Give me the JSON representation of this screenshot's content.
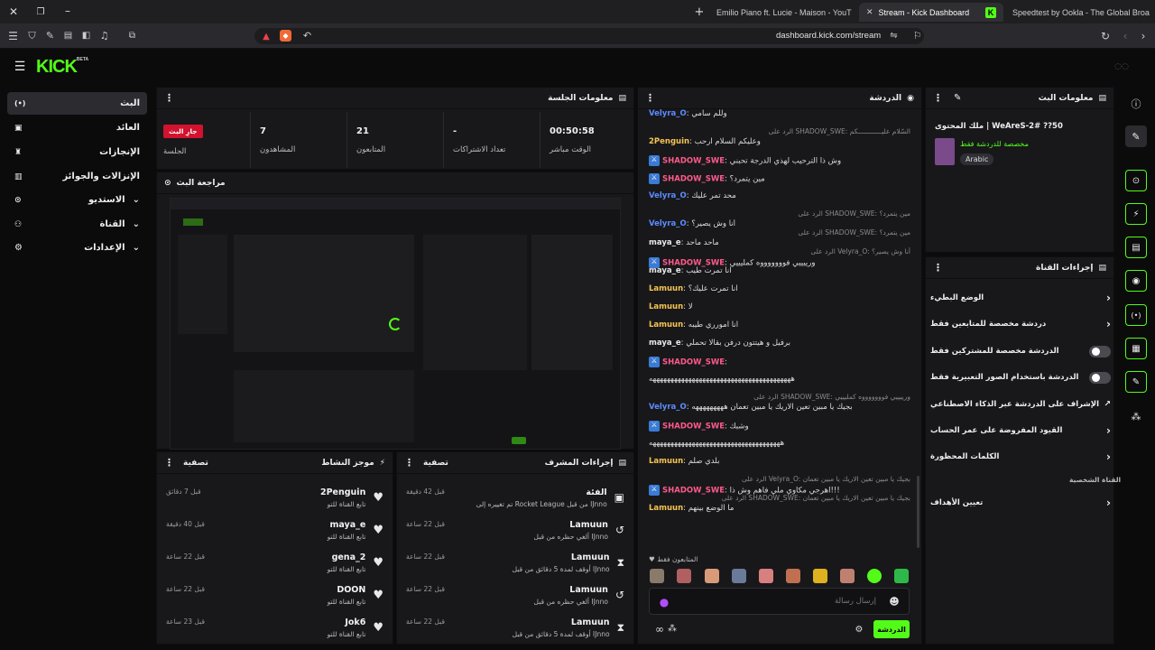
{
  "browser": {
    "tabs": [
      {
        "label": "Emilio Piano ft. Lucie - Maison - YouT"
      },
      {
        "label": "Stream - Kick Dashboard"
      },
      {
        "label": "Speedtest by Ookla - The Global Broa"
      }
    ],
    "url": "dashboard.kick.com/stream"
  },
  "brand": {
    "logo": "KICK",
    "beta": "BETA"
  },
  "sidebar": {
    "items": [
      {
        "label": "البث",
        "icon": "broadcast-icon"
      },
      {
        "label": "العائد",
        "icon": "wallet-icon"
      },
      {
        "label": "الإنجازات",
        "icon": "trophy-icon"
      },
      {
        "label": "الإنزالات والجوائز",
        "icon": "chart-icon"
      },
      {
        "label": "الاستديو",
        "icon": "studio-icon"
      },
      {
        "label": "القناة",
        "icon": "users-icon"
      },
      {
        "label": "الإعدادات",
        "icon": "gear-icon"
      }
    ]
  },
  "session": {
    "title": "معلومات الجلسة",
    "live_badge": "جارِ البث",
    "live_label": "الجلسة",
    "stats": [
      {
        "value": "7",
        "label": "المشاهدون"
      },
      {
        "value": "21",
        "label": "المتابعون"
      },
      {
        "value": "-",
        "label": "تعداد الاشتراكات"
      },
      {
        "value": "00:50:58",
        "label": "الوقت مباشر"
      }
    ]
  },
  "preview": {
    "title": "مراجعة البث"
  },
  "activity": {
    "title": "موجز النشاط",
    "filter": "تصفية",
    "items": [
      {
        "name": "2Penguin",
        "sub": "تابع القناة للتو",
        "time": "قبل 7 دقائق"
      },
      {
        "name": "maya_e",
        "sub": "تابع القناة للتو",
        "time": "قبل 40 دقيقة"
      },
      {
        "name": "gena_2",
        "sub": "تابع القناة للتو",
        "time": "قبل 22 ساعة"
      },
      {
        "name": "DOON",
        "sub": "تابع القناة للتو",
        "time": "قبل 22 ساعة"
      },
      {
        "name": "Jok6",
        "sub": "تابع القناة للتو",
        "time": "قبل 23 ساعة"
      }
    ]
  },
  "modactions": {
    "title": "إجراءات المشرف",
    "filter": "تصفية",
    "items": [
      {
        "name": "الفئة",
        "sub": "تم تغييره إلى Rocket League من قبل IJnno",
        "time": "قبل 42 دقيقة",
        "icon": "category-icon"
      },
      {
        "name": "Lamuun",
        "sub": "ألغي حظره من قبل IJnno",
        "time": "قبل 22 ساعة",
        "icon": "undo-icon"
      },
      {
        "name": "Lamuun",
        "sub": "أوقف لمدة 5 دقائق من قبل IJnno",
        "time": "قبل 22 ساعة",
        "icon": "hourglass-icon"
      },
      {
        "name": "Lamuun",
        "sub": "ألغي حظره من قبل IJnno",
        "time": "قبل 22 ساعة",
        "icon": "undo-icon"
      },
      {
        "name": "Lamuun",
        "sub": "أوقف لمدة 5 دقائق من قبل IJnno",
        "time": "قبل 22 ساعة",
        "icon": "hourglass-icon"
      }
    ]
  },
  "chat": {
    "title": "الدردشة",
    "lines": [
      {
        "reply": "",
        "user": "Velyra_O",
        "color": "#5b8cff",
        "text": "وللّم سامي",
        "badge": false
      },
      {
        "reply": "الرد على SHADOW_SWE: السّلام عليــــــــــــكم",
        "user": "",
        "color": "",
        "text": "",
        "badge": false
      },
      {
        "reply": "",
        "user": "2Penguin",
        "color": "#f5c451",
        "text": "وعليكم السلام ارحب",
        "badge": false
      },
      {
        "reply": "",
        "user": "SHADOW_SWE",
        "color": "#ff5a8a",
        "text": "وش ذا الترحيب لهذي الدرجة تحبني",
        "badge": true
      },
      {
        "reply": "",
        "user": "SHADOW_SWE",
        "color": "#ff5a8a",
        "text": "مين يتمرد؟",
        "badge": true
      },
      {
        "reply": "",
        "user": "Velyra_O",
        "color": "#5b8cff",
        "text": "محد تمر عليك",
        "badge": false
      },
      {
        "reply": "الرد على SHADOW_SWE: مين يتمرد؟",
        "user": "Velyra_O",
        "color": "#5b8cff",
        "text": "أنا وش يصير؟",
        "badge": false
      },
      {
        "reply": "الرد على SHADOW_SWE: مين يتمرد؟",
        "user": "maya_e",
        "color": "#e8e8e8",
        "text": "ماحد ماحد",
        "badge": false
      },
      {
        "reply": "الرد على Velyra_O: أنا وش يصير؟",
        "user": "SHADOW_SWE",
        "color": "#ff5a8a",
        "text": "ورييييي فوووووووه كمليييي",
        "badge": true
      },
      {
        "reply": "",
        "user": "maya_e",
        "color": "#e8e8e8",
        "text": "انا تمرت طيب",
        "badge": false
      },
      {
        "reply": "",
        "user": "Lamuun",
        "color": "#f5c451",
        "text": "انا تمرت عليك؟",
        "badge": false
      },
      {
        "reply": "",
        "user": "Lamuun",
        "color": "#f5c451",
        "text": "لا",
        "badge": false
      },
      {
        "reply": "",
        "user": "Lamuun",
        "color": "#f5c451",
        "text": "انا امورري طيبه",
        "badge": false
      },
      {
        "reply": "",
        "user": "maya_e",
        "color": "#e8e8e8",
        "text": "برفيل و هيتتون درفن بقالا تحملي",
        "badge": false
      },
      {
        "reply": "",
        "user": "SHADOW_SWE",
        "color": "#ff5a8a",
        "text": "",
        "badge": true
      },
      {
        "reply": "",
        "user": "",
        "color": "",
        "text": "ههههههههههههههههههههههههههههههههههههههههه",
        "badge": false
      },
      {
        "reply": "الرد على SHADOW_SWE: ورييييي فوووووووه كمليييي",
        "user": "",
        "color": "",
        "text": "",
        "badge": false
      },
      {
        "reply": "",
        "user": "Velyra_O",
        "color": "#5b8cff",
        "text": "بجيك يا مبين تعين الاريك يا مبين تعمان هههههههههه",
        "badge": false
      },
      {
        "reply": "",
        "user": "SHADOW_SWE",
        "color": "#ff5a8a",
        "text": "وشبك",
        "badge": true
      },
      {
        "reply": "",
        "user": "",
        "color": "",
        "text": "هههههههههههههههههههههههههههههههههههههه",
        "badge": false
      },
      {
        "reply": "",
        "user": "Lamuun",
        "color": "#f5c451",
        "text": "بلدي صلم",
        "badge": false
      },
      {
        "reply": "الرد على Velyra_O: بجيك يا مبين تعين الاريك يا مبين تعمان",
        "user": "SHADOW_SWE",
        "color": "#ff5a8a",
        "text": "اهرجي مكاوي ملي فاهم وش ذا!!!",
        "badge": true
      },
      {
        "reply": "الرد على SHADOW_SWE: بجيك يا مبين تعين الاريك يا مبين تعمان",
        "user": "Lamuun",
        "color": "#f5c451",
        "text": "ما الوضع بينهم",
        "badge": false
      }
    ],
    "followers_only": "المتابعون فقط",
    "input_placeholder": "إرسال رسالة",
    "send_label": "الدردشة"
  },
  "stream_info": {
    "title": "معلومات البث",
    "stream_title": "ملك المحتوى | WeAreS-2# ??50",
    "subtitle": "مخصصة للدردشة فقط",
    "language": "Arabic"
  },
  "channel_actions": {
    "title": "إجراءات القناة",
    "rows": [
      {
        "label": "الوضع البطيء",
        "control": "chevron"
      },
      {
        "label": "دردشة مخصصة للمتابعين فقط",
        "control": "chevron"
      },
      {
        "label": "الدردشة مخصصة للمشتركين فقط",
        "control": "toggle"
      },
      {
        "label": "الدردشة باستخدام الصور التعبيرية فقط",
        "control": "toggle"
      },
      {
        "label": "الإشراف على الدردشة عبر الذكاء الاصطناعي",
        "control": "external"
      },
      {
        "label": "القيود المفروضة على عمر الحساب",
        "control": "chevron"
      },
      {
        "label": "الكلمات المحظورة",
        "control": "chevron"
      }
    ],
    "section_label": "القناة الشخصية",
    "goals_label": "تعيين الأهداف"
  }
}
